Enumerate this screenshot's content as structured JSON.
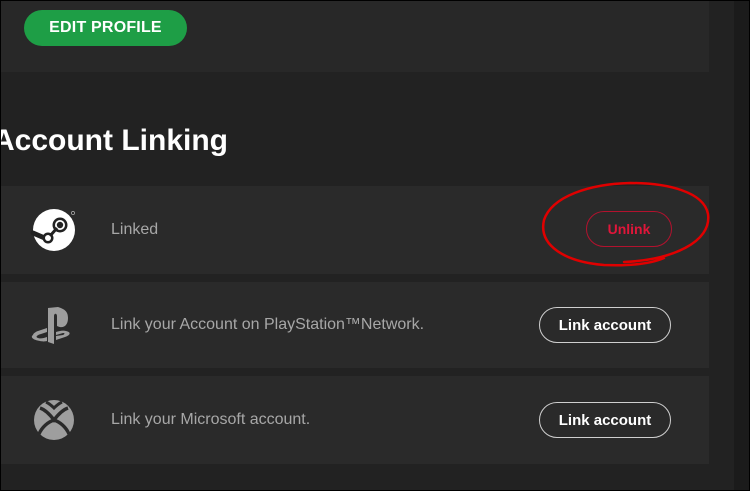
{
  "profile": {
    "edit_label": "EDIT PROFILE",
    "accent": "#1e9e46"
  },
  "account_linking": {
    "title": "Account Linking",
    "rows": [
      {
        "icon": "steam-icon",
        "label": "Linked",
        "action": "Unlink",
        "action_color": "#e0163a"
      },
      {
        "icon": "playstation-icon",
        "label": "Link your Account on PlayStation™Network.",
        "action": "Link account"
      },
      {
        "icon": "xbox-icon",
        "label": "Link your Microsoft account.",
        "action": "Link account"
      }
    ]
  },
  "annotation": {
    "color": "#e00000"
  }
}
